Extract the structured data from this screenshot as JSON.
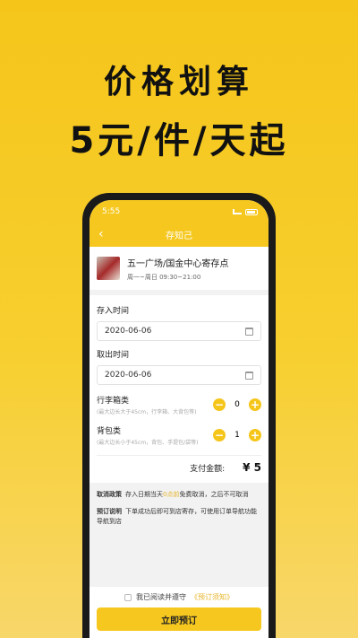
{
  "promo": {
    "line1": "价格划算",
    "line2": "5元/件/天起"
  },
  "status": {
    "time": "5:55"
  },
  "nav": {
    "back_icon": "‹",
    "title": "存知己"
  },
  "store": {
    "name": "五一广场/国金中心寄存点",
    "hours": "周一~周日 09:30~21:00"
  },
  "form": {
    "checkin_label": "存入时间",
    "checkin_value": "2020-06-06",
    "checkout_label": "取出时间",
    "checkout_value": "2020-06-06",
    "items": [
      {
        "title": "行李箱类",
        "desc": "(最大边长大于45cm，行李箱、大背包等)",
        "qty": "0",
        "minus": "−",
        "plus": "+"
      },
      {
        "title": "背包类",
        "desc": "(最大边长小于45cm，背包、手提包/袋等)",
        "qty": "1",
        "minus": "−",
        "plus": "+"
      }
    ],
    "total_label": "支付金额:",
    "total_value": "¥ 5"
  },
  "policy": {
    "cancel_label": "取消政策",
    "cancel_pre": "存入日期当天",
    "cancel_hl": "0点前",
    "cancel_post": "免费取消，之后不可取消",
    "book_label": "预订说明",
    "book_text": "下单成功后即可到店寄存，可使用订单导航功能导航到店"
  },
  "footer": {
    "agree_text": "我已阅读并遵守",
    "agree_link": "《预订须知》",
    "button": "立即预订"
  },
  "colors": {
    "accent": "#f6c81f",
    "highlight": "#e7b42a"
  }
}
